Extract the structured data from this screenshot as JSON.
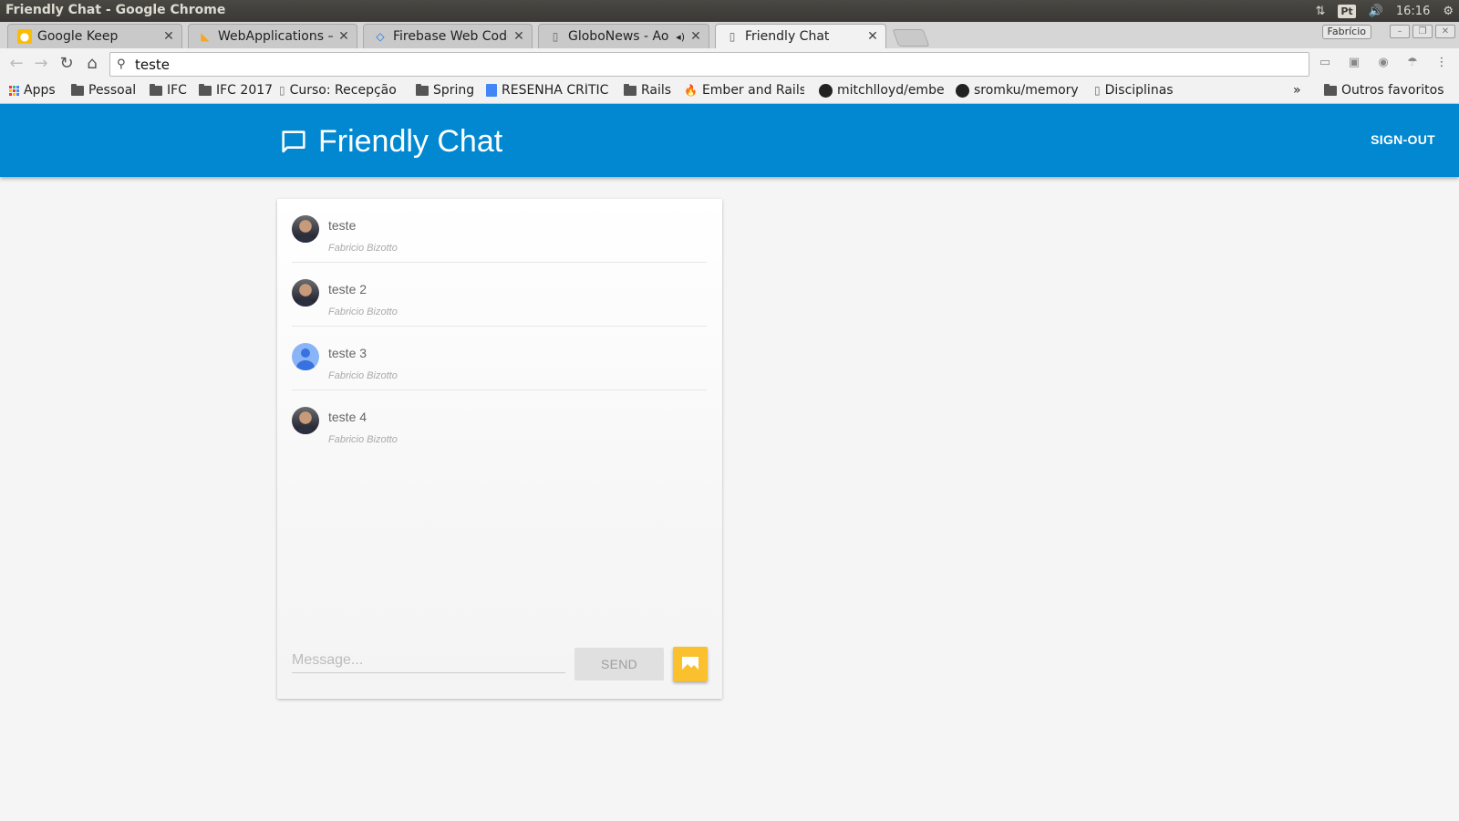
{
  "os": {
    "window_title": "Friendly Chat - Google Chrome",
    "lang": "Pt",
    "time": "16:16"
  },
  "browser": {
    "profile": "Fabrício",
    "tabs": [
      {
        "title": "Google Keep",
        "icon": "keep-icon"
      },
      {
        "title": "WebApplications –",
        "icon": "firebase-icon"
      },
      {
        "title": "Firebase Web Code",
        "icon": "code-icon"
      },
      {
        "title": "GloboNews - Ao V",
        "icon": "page-icon"
      },
      {
        "title": "Friendly Chat",
        "icon": "page-icon",
        "active": true
      }
    ],
    "omnibox_text": "teste",
    "bookmarks": [
      "Apps",
      "Pessoal",
      "IFC",
      "IFC 2017",
      "Curso: Recepção",
      "Spring",
      "RESENHA CRÍTIC",
      "Rails",
      "Ember and Rails",
      "mitchlloyd/embe",
      "sromku/memory",
      "Disciplinas",
      "»",
      "Outros favoritos"
    ]
  },
  "app": {
    "title": "Friendly Chat",
    "signout_label": "SIGN-OUT",
    "brand_color": "#0288d1"
  },
  "messages": [
    {
      "text": "teste",
      "name": "Fabricio Bizotto",
      "avatar": "photo"
    },
    {
      "text": "teste 2",
      "name": "Fabricio Bizotto",
      "avatar": "photo"
    },
    {
      "text": "teste 3",
      "name": "Fabricio Bizotto",
      "avatar": "generic"
    },
    {
      "text": "teste 4",
      "name": "Fabricio Bizotto",
      "avatar": "photo"
    }
  ],
  "composer": {
    "placeholder": "Message...",
    "value": "",
    "send_label": "SEND",
    "image_button_color": "#fbc02d"
  }
}
